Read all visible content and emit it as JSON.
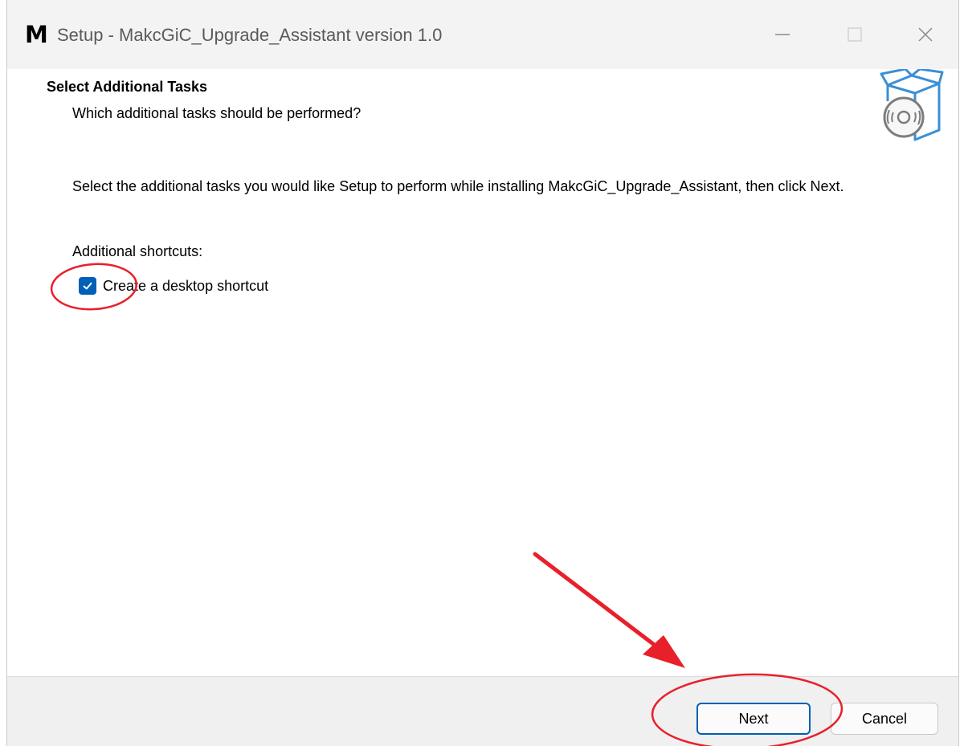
{
  "window": {
    "title": "Setup - MakcGiC_Upgrade_Assistant version 1.0",
    "logo_text": "M"
  },
  "titlebar_controls": {
    "minimize_icon": "minimize-icon",
    "maximize_icon": "maximize-icon",
    "close_icon": "close-icon"
  },
  "header": {
    "title": "Select Additional Tasks",
    "subtitle": "Which additional tasks should be performed?",
    "icon": "setup-box-disc-icon"
  },
  "main": {
    "instructions": "Select the additional tasks you would like Setup to perform while installing MakcGiC_Upgrade_Assistant, then click Next.",
    "shortcuts_label": "Additional shortcuts:",
    "tasks": [
      {
        "label": "Create a desktop shortcut",
        "checked": true
      }
    ]
  },
  "footer": {
    "next_label": "Next",
    "cancel_label": "Cancel"
  },
  "colors": {
    "accent": "#005fb8",
    "annotation": "#e8202a",
    "titlebar_bg": "#f3f3f3",
    "footer_bg": "#f0f0f0"
  }
}
